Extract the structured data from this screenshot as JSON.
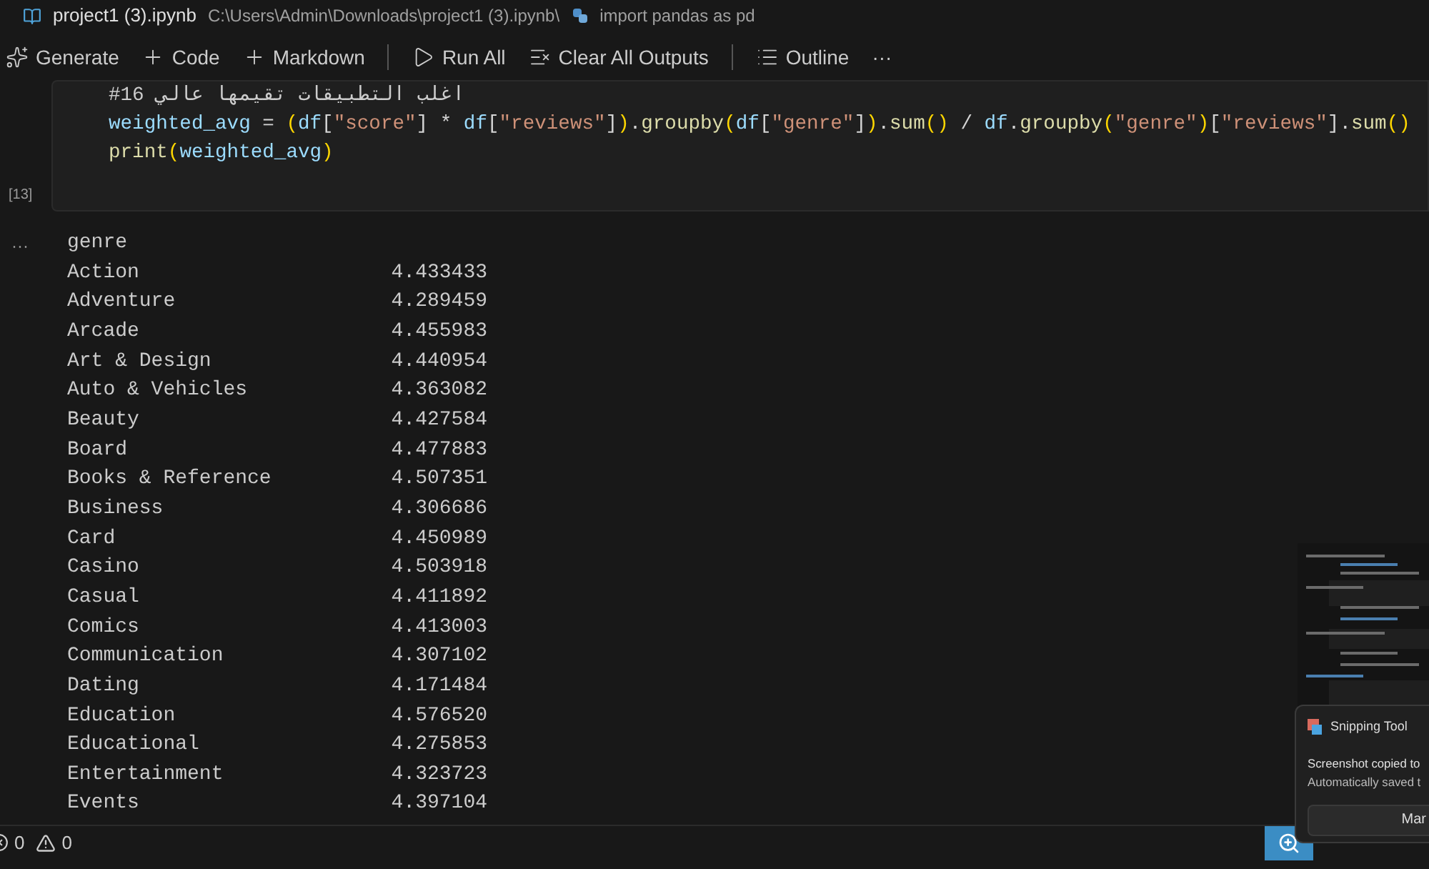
{
  "title_bar": {
    "file": "project1 (3).ipynb",
    "breadcrumb": "C:\\Users\\Admin\\Downloads\\project1 (3).ipynb\\",
    "symbol": "import pandas as pd"
  },
  "toolbar": [
    {
      "kind": "sparkle",
      "label": "Generate"
    },
    {
      "kind": "plus",
      "label": "Code"
    },
    {
      "kind": "plus",
      "label": "Markdown"
    },
    {
      "kind": "divider"
    },
    {
      "kind": "run",
      "label": "Run All"
    },
    {
      "kind": "clear",
      "label": "Clear All Outputs"
    },
    {
      "kind": "divider"
    },
    {
      "kind": "outline",
      "label": "Outline"
    },
    {
      "kind": "more",
      "label": "···"
    }
  ],
  "cell": {
    "execution_count": "[13]",
    "lines": [
      [
        {
          "kind": "comment",
          "text": "#16 اغلب التطبيقات تقيمها عالي"
        }
      ],
      [
        {
          "kind": "var",
          "text": "weighted_avg"
        },
        {
          "kind": "op",
          "text": " = "
        },
        {
          "kind": "paren",
          "text": "("
        },
        {
          "kind": "var",
          "text": "df"
        },
        {
          "kind": "op",
          "text": "["
        },
        {
          "kind": "str",
          "text": "\"score\""
        },
        {
          "kind": "op",
          "text": "] * "
        },
        {
          "kind": "var",
          "text": "df"
        },
        {
          "kind": "op",
          "text": "["
        },
        {
          "kind": "str",
          "text": "\"reviews\""
        },
        {
          "kind": "op",
          "text": "]"
        },
        {
          "kind": "paren",
          "text": ")"
        },
        {
          "kind": "op",
          "text": "."
        },
        {
          "kind": "func",
          "text": "groupby"
        },
        {
          "kind": "paren",
          "text": "("
        },
        {
          "kind": "var",
          "text": "df"
        },
        {
          "kind": "op",
          "text": "["
        },
        {
          "kind": "str",
          "text": "\"genre\""
        },
        {
          "kind": "op",
          "text": "]"
        },
        {
          "kind": "paren",
          "text": ")"
        },
        {
          "kind": "op",
          "text": "."
        },
        {
          "kind": "func",
          "text": "sum"
        },
        {
          "kind": "paren",
          "text": "()"
        },
        {
          "kind": "op",
          "text": " / "
        },
        {
          "kind": "var",
          "text": "df"
        },
        {
          "kind": "op",
          "text": "."
        },
        {
          "kind": "func",
          "text": "groupby"
        },
        {
          "kind": "paren",
          "text": "("
        },
        {
          "kind": "str",
          "text": "\"genre\""
        },
        {
          "kind": "paren",
          "text": ")"
        },
        {
          "kind": "op",
          "text": "["
        },
        {
          "kind": "str",
          "text": "\"reviews\""
        },
        {
          "kind": "op",
          "text": "]."
        },
        {
          "kind": "func",
          "text": "sum"
        },
        {
          "kind": "paren",
          "text": "()"
        }
      ],
      [
        {
          "kind": "func",
          "text": "print"
        },
        {
          "kind": "paren",
          "text": "("
        },
        {
          "kind": "var",
          "text": "weighted_avg"
        },
        {
          "kind": "paren",
          "text": ")"
        }
      ]
    ]
  },
  "output": {
    "marker": "···",
    "header": "genre",
    "rows": [
      {
        "name": "Action",
        "value": "4.433433"
      },
      {
        "name": "Adventure",
        "value": "4.289459"
      },
      {
        "name": "Arcade",
        "value": "4.455983"
      },
      {
        "name": "Art & Design",
        "value": "4.440954"
      },
      {
        "name": "Auto & Vehicles",
        "value": "4.363082"
      },
      {
        "name": "Beauty",
        "value": "4.427584"
      },
      {
        "name": "Board",
        "value": "4.477883"
      },
      {
        "name": "Books & Reference",
        "value": "4.507351"
      },
      {
        "name": "Business",
        "value": "4.306686"
      },
      {
        "name": "Card",
        "value": "4.450989"
      },
      {
        "name": "Casino",
        "value": "4.503918"
      },
      {
        "name": "Casual",
        "value": "4.411892"
      },
      {
        "name": "Comics",
        "value": "4.413003"
      },
      {
        "name": "Communication",
        "value": "4.307102"
      },
      {
        "name": "Dating",
        "value": "4.171484"
      },
      {
        "name": "Education",
        "value": "4.576520"
      },
      {
        "name": "Educational",
        "value": "4.275853"
      },
      {
        "name": "Entertainment",
        "value": "4.323723"
      },
      {
        "name": "Events",
        "value": "4.397104"
      }
    ]
  },
  "toast": {
    "app": "Snipping Tool",
    "line1": "Screenshot copied to",
    "line2": "Automatically saved t",
    "button": "Mar"
  },
  "status_bar": {
    "errors": "0",
    "warnings": "0"
  }
}
